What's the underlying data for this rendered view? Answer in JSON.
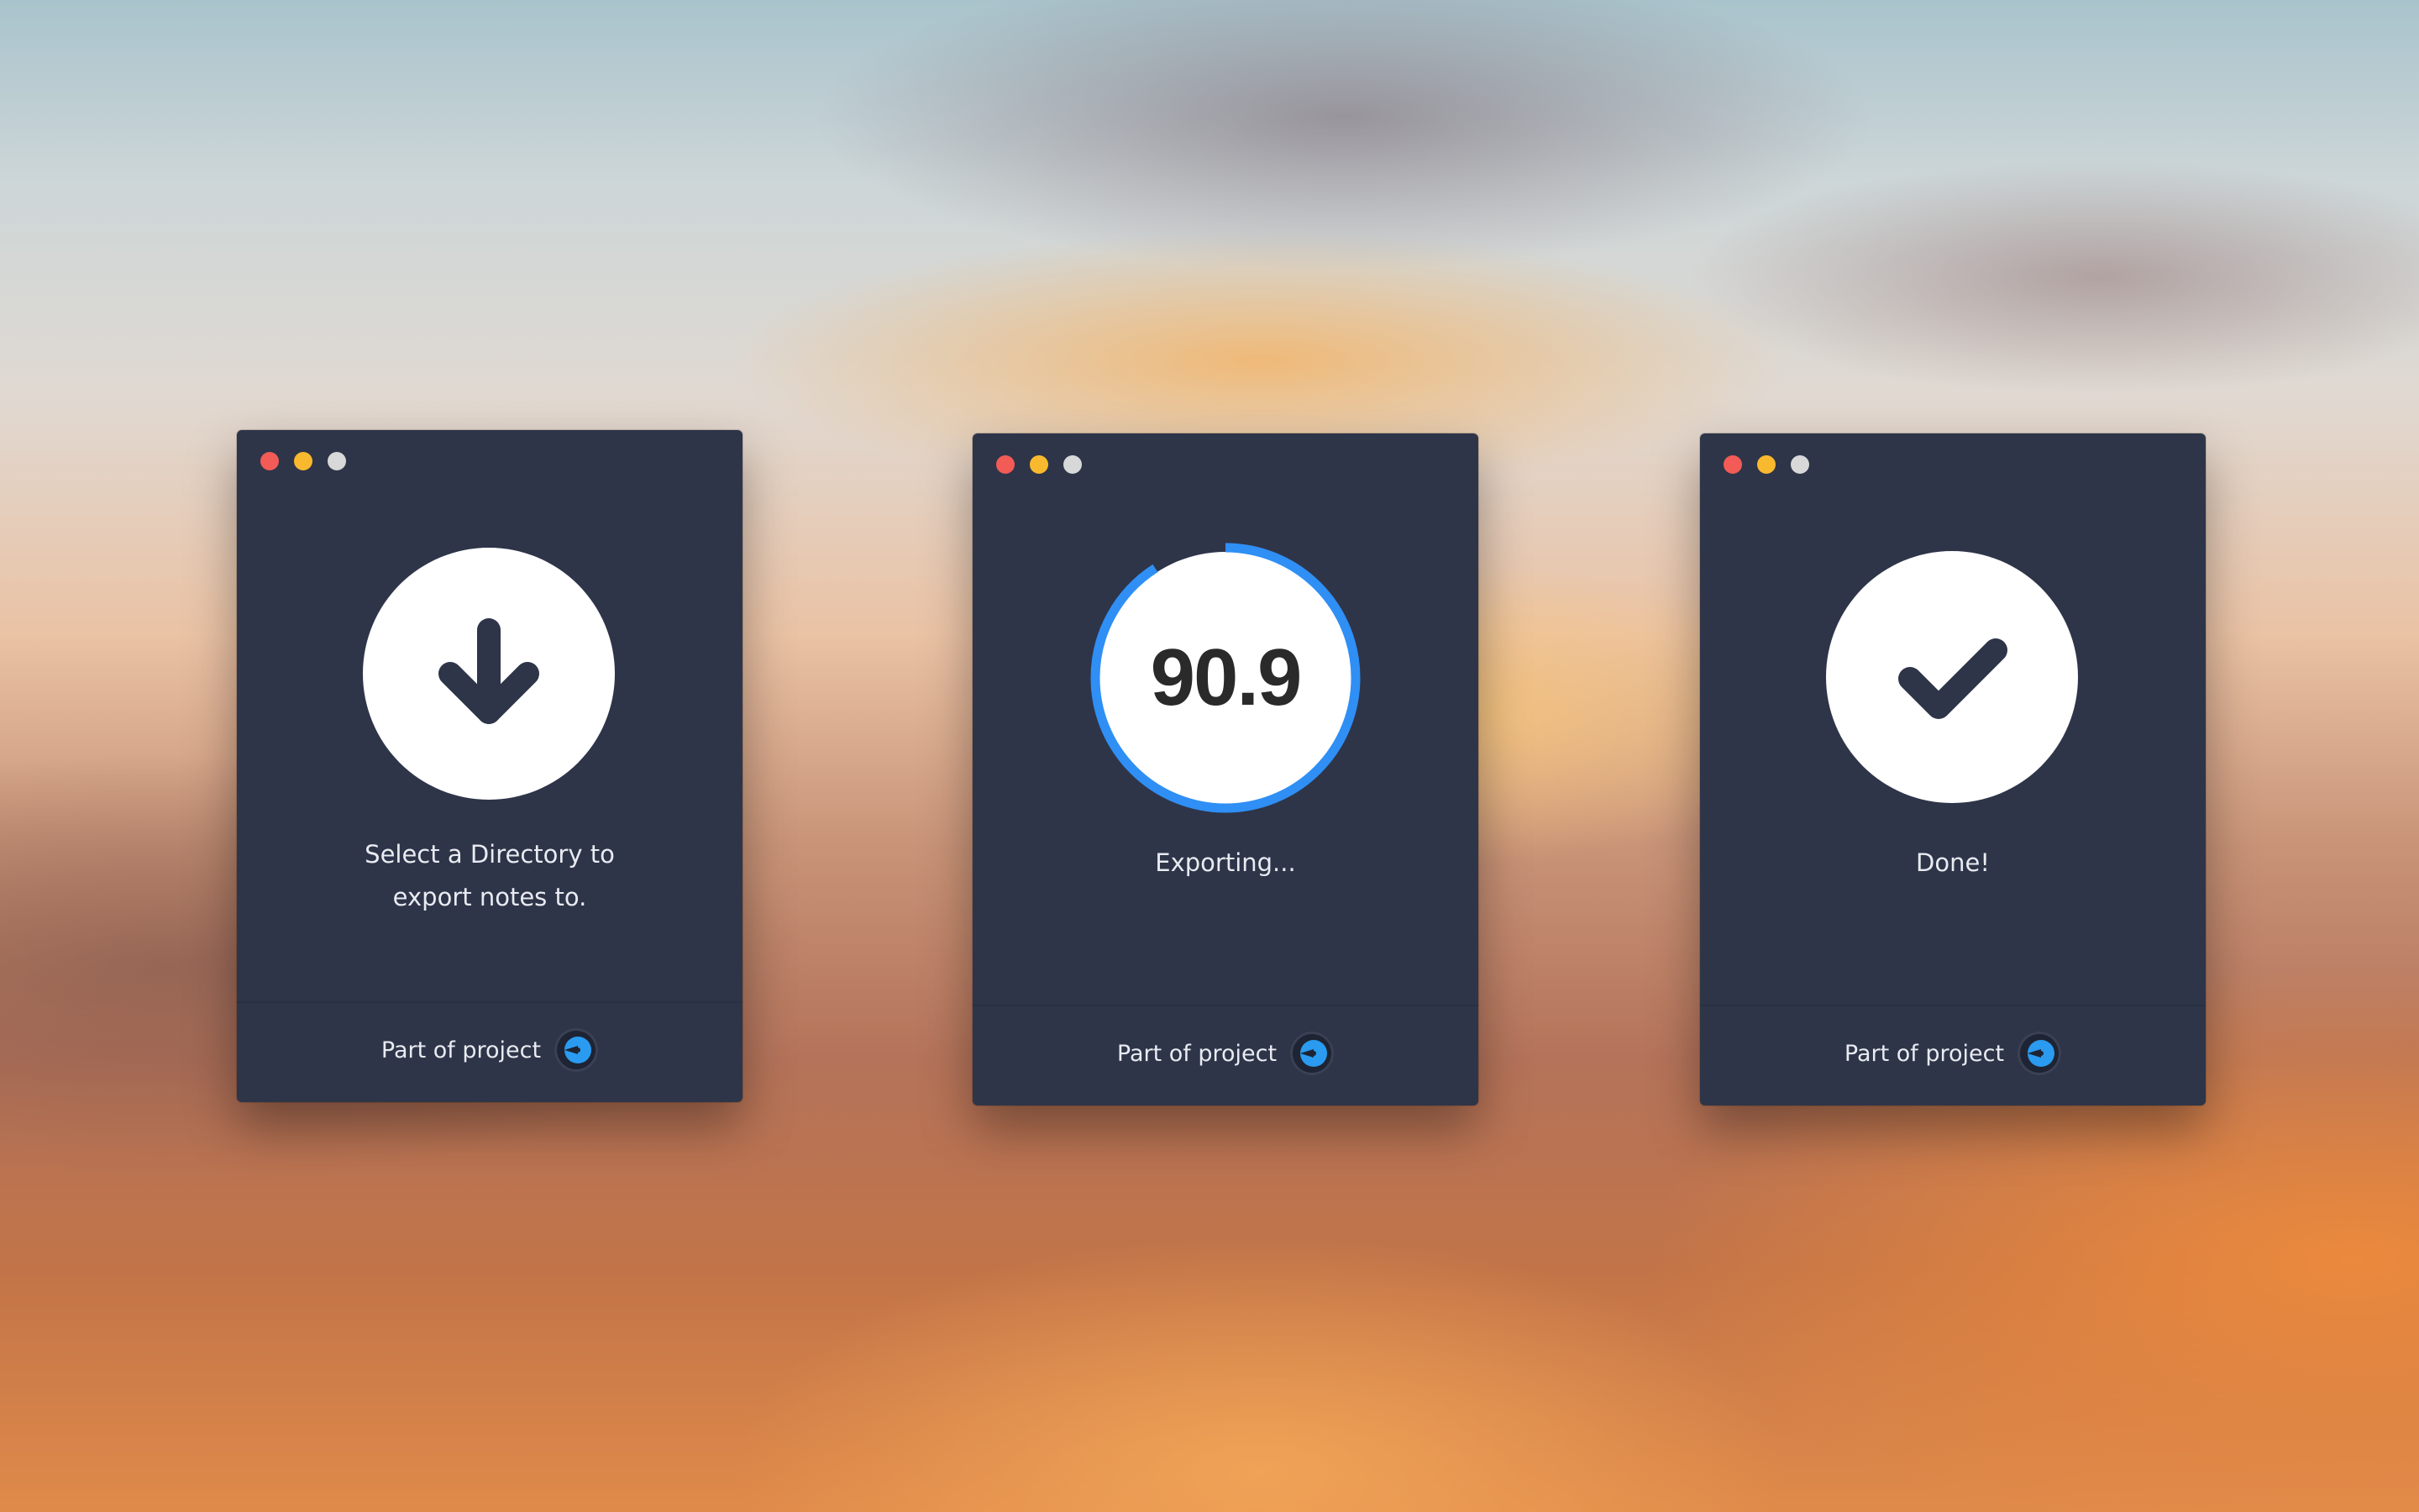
{
  "windows": [
    {
      "state": "select",
      "message_line1": "Select a Directory to",
      "message_line2": "export notes to.",
      "footer_text": "Part of project",
      "icon": "arrow-down-icon"
    },
    {
      "state": "exporting",
      "progress_value": "90.9",
      "progress_fraction": 0.909,
      "message_line1": "Exporting...",
      "footer_text": "Part of project",
      "icon": "progress-ring"
    },
    {
      "state": "done",
      "message_line1": "Done!",
      "footer_text": "Part of project",
      "icon": "checkmark-icon"
    }
  ],
  "colors": {
    "window_bg": "#2e3549",
    "accent_blue": "#2f8ff5",
    "traffic_red": "#f25b56",
    "traffic_yellow": "#f9b92e",
    "traffic_gray": "#d8d8d8",
    "icon_dark": "#2e3549"
  }
}
